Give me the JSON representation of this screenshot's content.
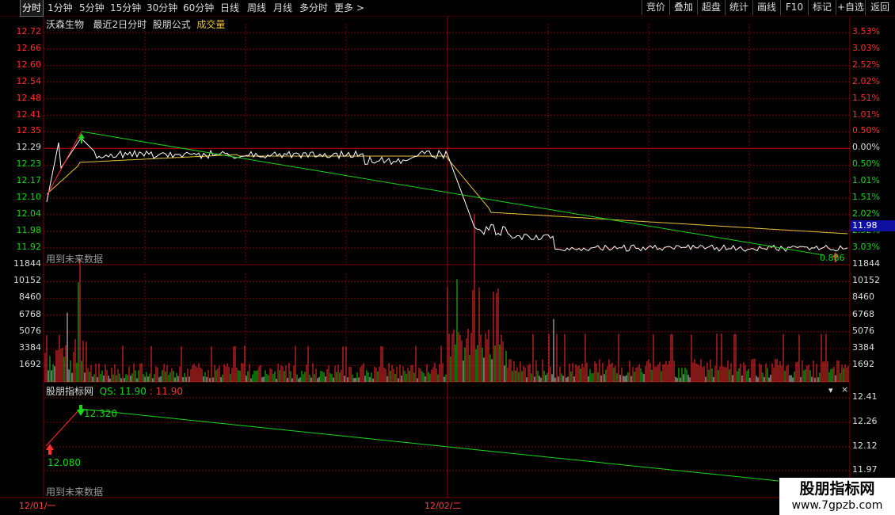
{
  "toolbar": {
    "tabs": [
      "分时",
      "1分钟",
      "5分钟",
      "15分钟",
      "30分钟",
      "60分钟",
      "日线",
      "周线",
      "月线",
      "多分时",
      "更多 >"
    ],
    "right_buttons": [
      "竞价",
      "叠加",
      "超盘",
      "统计",
      "画线",
      "F10",
      "标记",
      "+自选",
      "返回"
    ]
  },
  "header": {
    "stock_name": "沃森生物",
    "period": "最近2日分时",
    "formula": "股朋公式",
    "volume_label": "成交量"
  },
  "price_axis": {
    "left_labels": [
      "12.72",
      "12.66",
      "12.60",
      "12.54",
      "12.48",
      "12.41",
      "12.35",
      "12.29",
      "12.23",
      "12.17",
      "12.10",
      "12.04",
      "11.98",
      "11.92"
    ],
    "right_labels": [
      "3.53%",
      "3.03%",
      "2.52%",
      "2.02%",
      "1.51%",
      "1.01%",
      "0.50%",
      "0.00%",
      "0.50%",
      "1.01%",
      "1.51%",
      "2.02%",
      "2.52%",
      "3.03%"
    ],
    "current_price_tag": "11.98"
  },
  "volume_axis": {
    "labels": [
      "11844",
      "10152",
      "8460",
      "6768",
      "5076",
      "3384",
      "1692"
    ]
  },
  "future_data_label": "用到未来数据",
  "indicator": {
    "name": "股朋指标网",
    "qs_label": "QS: 11.90",
    "qs_value": ": 11.90",
    "axis_labels": [
      "12.41",
      "12.26",
      "12.12",
      "11.97"
    ],
    "point_low": "12.080",
    "point_high": "12.320",
    "close_icon": "×",
    "dropdown_icon": "▾"
  },
  "marker_text": "0.886",
  "dates": [
    "12/01/一",
    "12/02/二"
  ],
  "watermark": {
    "title": "股朋指标网",
    "url": "www.7gpzb.com"
  },
  "colors": {
    "up": "#ff3030",
    "down": "#18d818",
    "price_line": "#ffffff",
    "avg_line": "#e8c53a",
    "grid": "#7a0000"
  }
}
